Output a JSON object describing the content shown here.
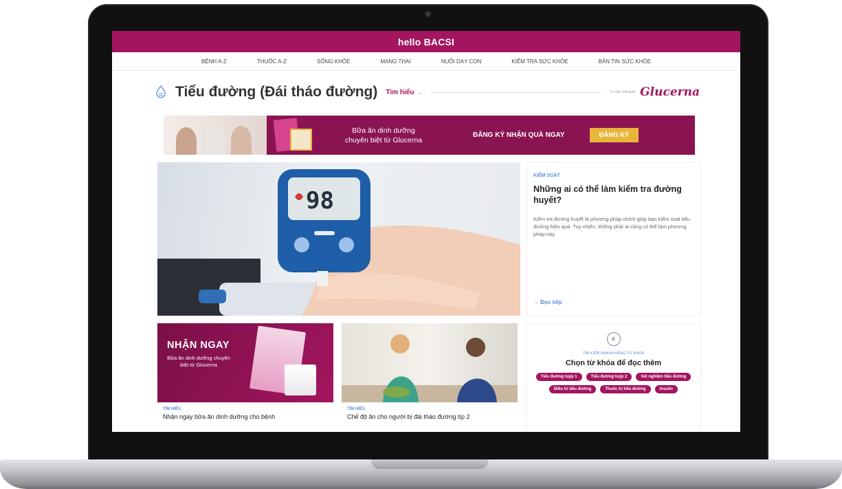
{
  "site": {
    "logo": "hello BACSI"
  },
  "nav": {
    "items": [
      "BỆNH A-Z",
      "THUỐC A-Z",
      "SỐNG KHỎE",
      "MANG THAI",
      "NUÔI DẠY CON",
      "KIỂM TRA SỨC KHỎE",
      "BẢN TIN SỨC KHỎE"
    ]
  },
  "page": {
    "title": "Tiểu đường (Đái tháo đường)",
    "learn": "Tìm hiểu",
    "sponsor_text": "Tư vấn chứng tin",
    "brand": "Glucerna"
  },
  "banner": {
    "text_line1": "Bữa ăn dinh dưỡng",
    "text_line2": "chuyên biệt từ Glucerna",
    "cta": "ĐĂNG KÝ NHẬN QUÀ NGAY",
    "button": "ĐĂNG KÝ"
  },
  "hero": {
    "meter_reading": "98",
    "category": "KIỂM SOÁT",
    "title": "Những ai có thể làm kiểm tra đường huyết?",
    "description": "Kiểm tra đường huyết là phương pháp chính giúp bạn kiểm soát tiểu đường hiệu quả. Tuy nhiên, không phải ai cũng có thể làm phương pháp này.",
    "read_more": "→ Đọc tiếp"
  },
  "cards": [
    {
      "promo_headline": "NHẬN NGAY",
      "promo_sub": "Bữa ăn dinh dưỡng chuyên biệt từ Glucerna",
      "category": "TÌM HIỂU",
      "title": "Nhận ngay bữa ăn dinh dưỡng cho bệnh"
    },
    {
      "category": "TÌM HIỂU",
      "title": "Chế độ ăn cho người bị đái tháo đường típ 2"
    }
  ],
  "keywords": {
    "icon_glyph": "#",
    "label": "TÌM KIẾM NHANH BẰNG TỪ KHÓA",
    "title": "Chọn từ khóa để đọc thêm",
    "tags": [
      "Tiểu đường tuýp 1",
      "Tiểu đường tuýp 2",
      "Xét nghiệm tiểu đường",
      "Điều trị tiểu đường",
      "Thuốc trị tiểu đường",
      "Insulin"
    ]
  },
  "colors": {
    "brand": "#a3155e",
    "accent_blue": "#5a8fd6",
    "banner_button": "#e8b53b"
  }
}
